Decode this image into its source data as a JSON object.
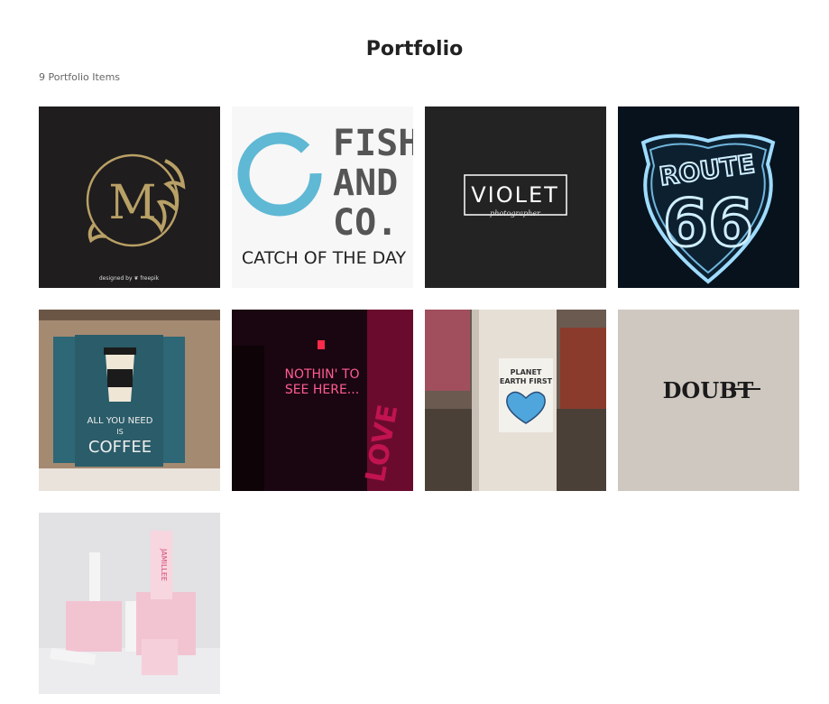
{
  "page": {
    "title": "Portfolio",
    "count_label": "9 Portfolio Items"
  },
  "items": [
    {
      "name": "monogram-logo",
      "text": "M",
      "credit": "designed by ❦ freepik"
    },
    {
      "name": "fish-and-co",
      "lines": [
        "FISH",
        "AND",
        "CO."
      ],
      "tagline": "CATCH OF THE DAY"
    },
    {
      "name": "violet-logo",
      "text": "VIOLET",
      "sub": "photographer"
    },
    {
      "name": "route-66-sign",
      "line1": "ROUTE",
      "line2": "66"
    },
    {
      "name": "coffee-poster",
      "lines": [
        "ALL YOU NEED",
        "IS",
        "COFFEE"
      ]
    },
    {
      "name": "neon-sign",
      "lines": [
        "NOTHIN' TO",
        "SEE HERE..."
      ],
      "side": "LOVE"
    },
    {
      "name": "planet-earth-sticker",
      "lines": [
        "PLANET",
        "EARTH FIRST"
      ]
    },
    {
      "name": "doubt-logo",
      "text": "DOUBT"
    },
    {
      "name": "jamillee-product",
      "text": "JAMILLEE"
    }
  ],
  "colors": {
    "gold": "#b9a066",
    "teal": "#5fb8d4",
    "neon_pink": "#ff4f8b",
    "sign_blue": "#9fdcff",
    "doubt_bg": "#cfc8c0",
    "product_pink": "#f2c4d2"
  }
}
